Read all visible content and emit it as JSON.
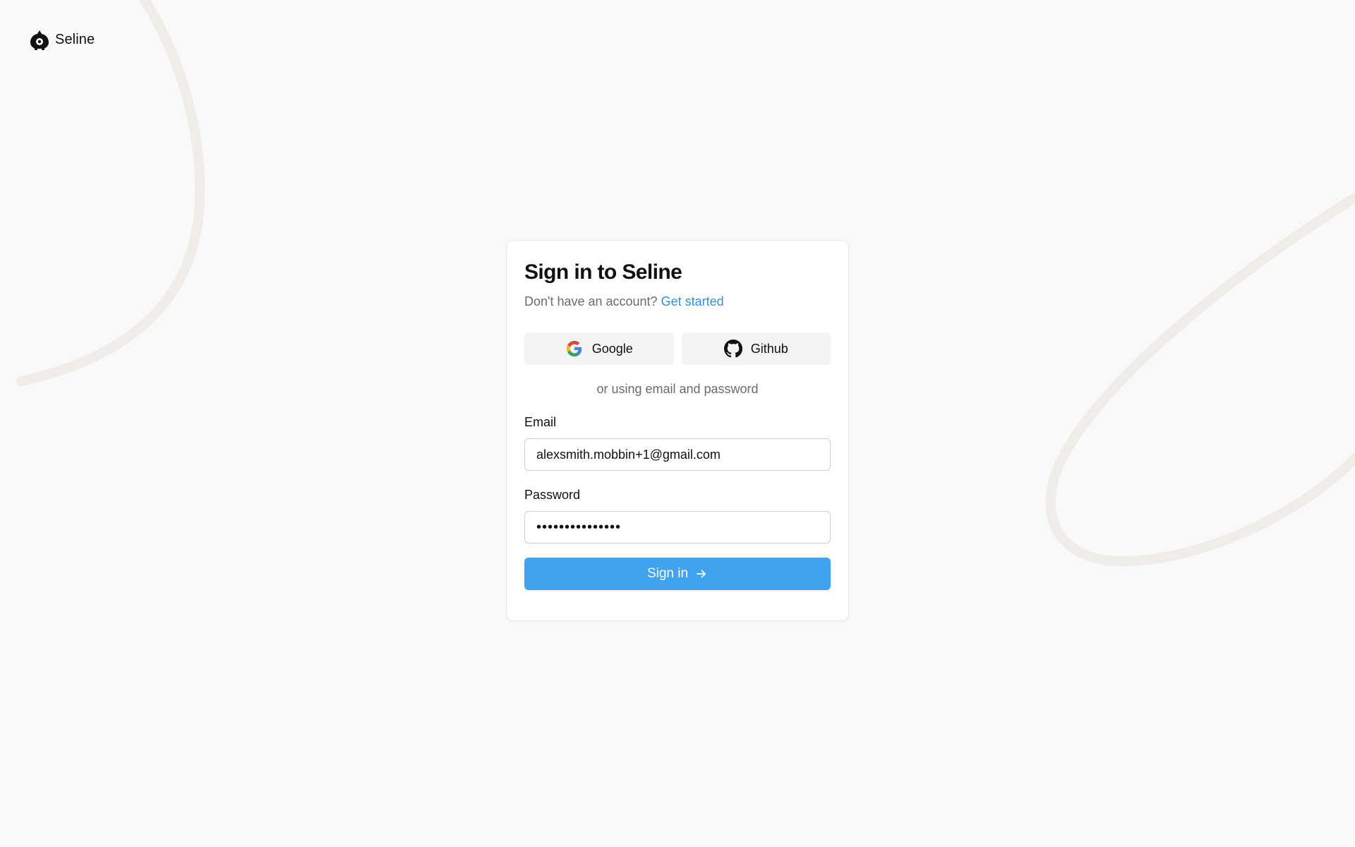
{
  "brand": {
    "name": "Seline",
    "logo_icon": "seline-logo-icon"
  },
  "signin": {
    "title": "Sign in to Seline",
    "no_account_text": "Don't have an account?",
    "get_started_link": "Get started",
    "oauth": {
      "google_label": "Google",
      "google_icon": "google-icon",
      "github_label": "Github",
      "github_icon": "github-icon"
    },
    "divider_text": "or using email and password",
    "email": {
      "label": "Email",
      "value": "alexsmith.mobbin+1@gmail.com"
    },
    "password": {
      "label": "Password",
      "value": "•••••••••••••••"
    },
    "submit_label": "Sign in",
    "submit_icon": "arrow-right-icon"
  },
  "colors": {
    "background": "#f9f9f9",
    "accent": "#3fa3ee",
    "link": "#2f8fe0",
    "muted_text": "#6b6b6b"
  }
}
